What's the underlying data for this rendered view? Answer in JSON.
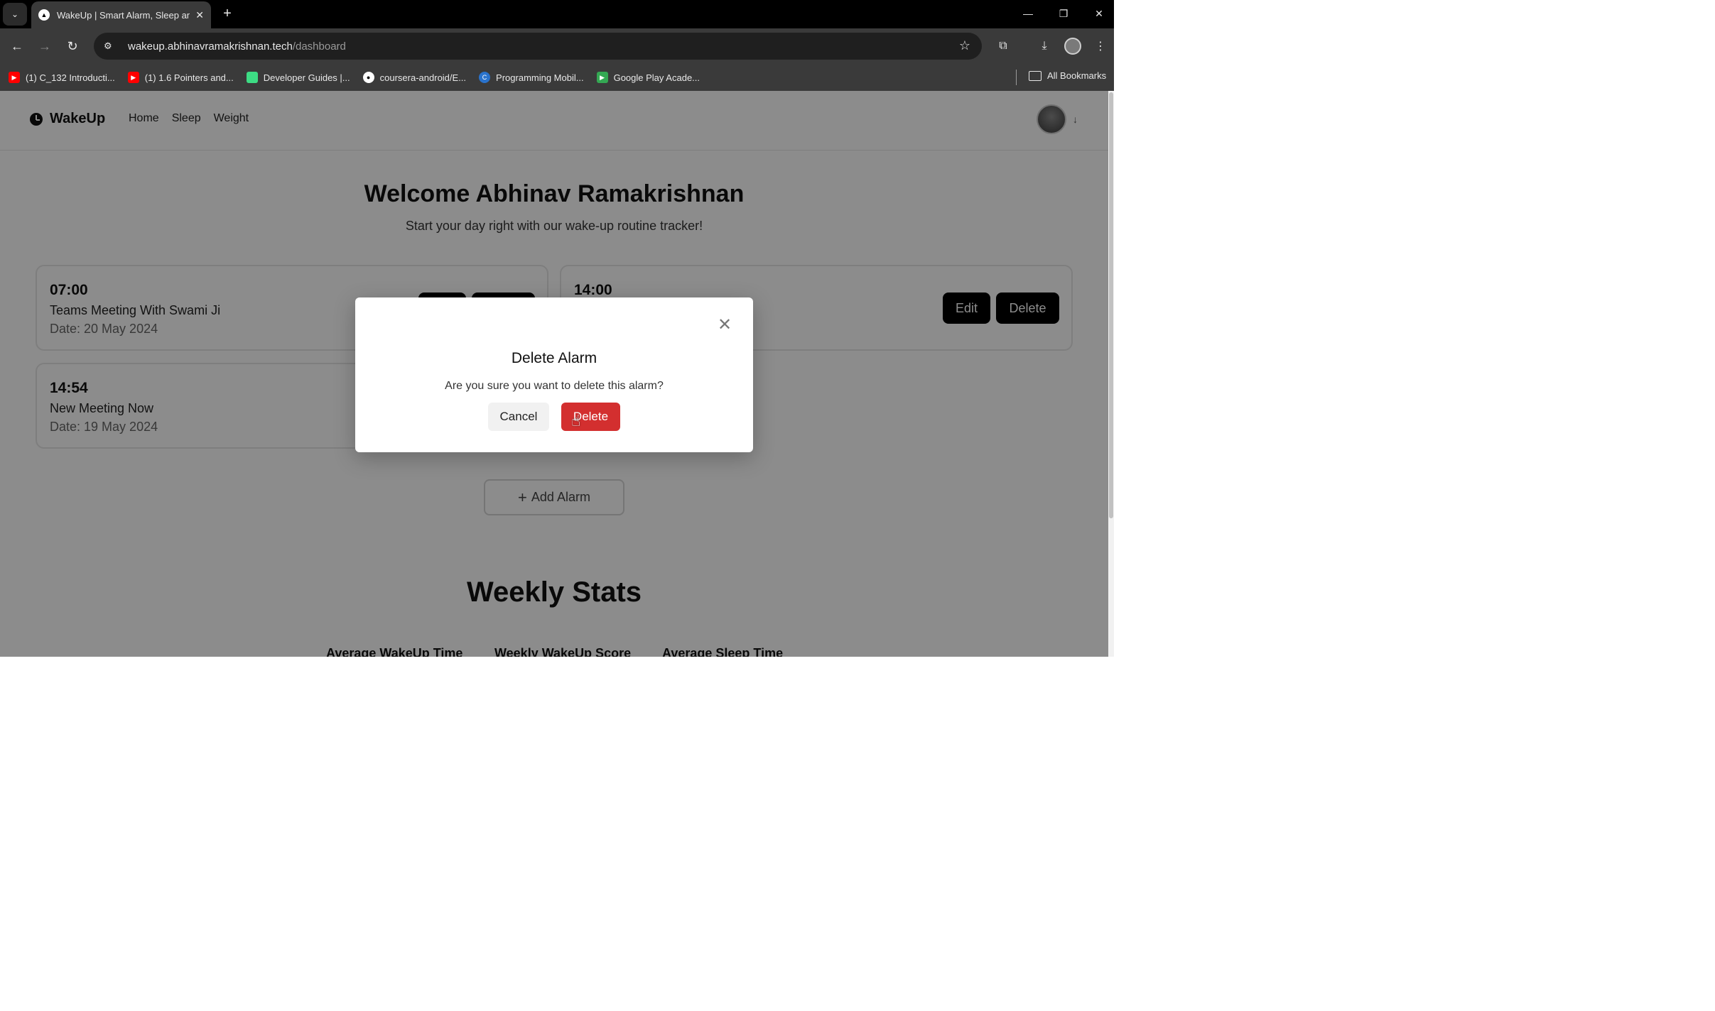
{
  "browser": {
    "tab_title": "WakeUp | Smart Alarm, Sleep an",
    "url_host": "wakeup.abhinavramakrishnan.tech",
    "url_path": "/dashboard",
    "bookmarks": [
      {
        "label": "(1) C_132 Introducti...",
        "icon": "youtube-icon",
        "color": "#ff0000"
      },
      {
        "label": "(1) 1.6 Pointers and...",
        "icon": "youtube-icon",
        "color": "#ff0000"
      },
      {
        "label": "Developer Guides |...",
        "icon": "android-icon",
        "color": "#3ddc84"
      },
      {
        "label": "coursera-android/E...",
        "icon": "github-icon",
        "color": "#ffffff"
      },
      {
        "label": "Programming Mobil...",
        "icon": "coursera-icon",
        "color": "#2a73cc"
      },
      {
        "label": "Google Play Acade...",
        "icon": "google-play-icon",
        "color": "#34a853"
      }
    ],
    "all_bookmarks": "All Bookmarks"
  },
  "app": {
    "brand": "WakeUp",
    "nav": [
      "Home",
      "Sleep",
      "Weight"
    ],
    "welcome": "Welcome Abhinav Ramakrishnan",
    "tagline": "Start your day right with our wake-up routine tracker!",
    "alarms": [
      {
        "time": "07:00",
        "label": "Teams Meeting With Swami Ji",
        "date": "Date: 20 May 2024"
      },
      {
        "time": "14:00",
        "label": "",
        "date": ""
      },
      {
        "time": "14:54",
        "label": "New Meeting Now",
        "date": "Date: 19 May 2024"
      }
    ],
    "edit_label": "Edit",
    "delete_label": "Delete",
    "add_alarm": "Add Alarm",
    "weekly_title": "Weekly Stats",
    "stats": [
      "Average WakeUp Time",
      "Weekly WakeUp Score",
      "Average Sleep Time"
    ]
  },
  "modal": {
    "title": "Delete Alarm",
    "message": "Are you sure you want to delete this alarm?",
    "cancel": "Cancel",
    "delete": "Delete"
  },
  "colors": {
    "danger": "#d32f2f",
    "primary_button": "#000000"
  }
}
